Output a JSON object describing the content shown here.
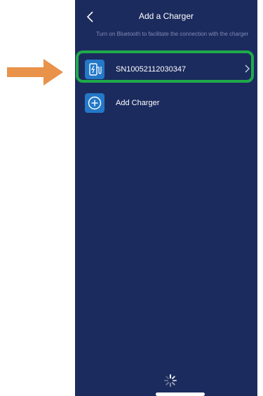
{
  "header": {
    "title": "Add a Charger"
  },
  "hint": {
    "text": "Turn on Bluetooth to facilitate the connection with the charger"
  },
  "chargers": [
    {
      "serial": "SN10052112030347"
    }
  ],
  "add_charger": {
    "label": "Add Charger"
  },
  "colors": {
    "background": "#1c2b5e",
    "icon_tile": "#2378c8",
    "highlight": "#1faa4a",
    "annotation_arrow": "#e8924a"
  },
  "icons": {
    "back": "chevron-left-icon",
    "charger": "ev-charger-icon",
    "chevron": "chevron-right-icon",
    "add": "plus-circle-icon",
    "loading": "loading-spinner-icon",
    "annotation": "arrow-right-icon"
  }
}
